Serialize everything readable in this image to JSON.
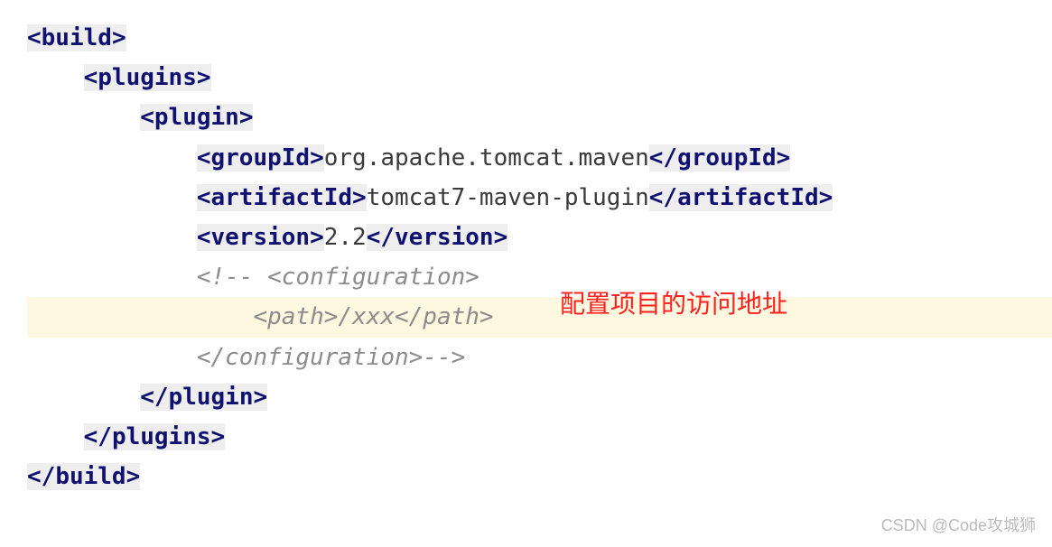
{
  "code": {
    "line1_tag": "build",
    "line2_tag": "plugins",
    "line3_tag": "plugin",
    "line4_tag": "groupId",
    "line4_text": "org.apache.tomcat.maven",
    "line5_tag": "artifactId",
    "line5_text": "tomcat7-maven-plugin",
    "line6_tag": "version",
    "line6_text": "2.2",
    "line7_comment": "<!-- <configuration>",
    "line8_comment": "    <path>/xxx</path>",
    "line9_comment": "</configuration>-->",
    "line10_tag": "plugin",
    "line11_tag": "plugins",
    "line12_tag": "build"
  },
  "annotation": "配置项目的访问地址",
  "watermark": "CSDN @Code攻城狮"
}
